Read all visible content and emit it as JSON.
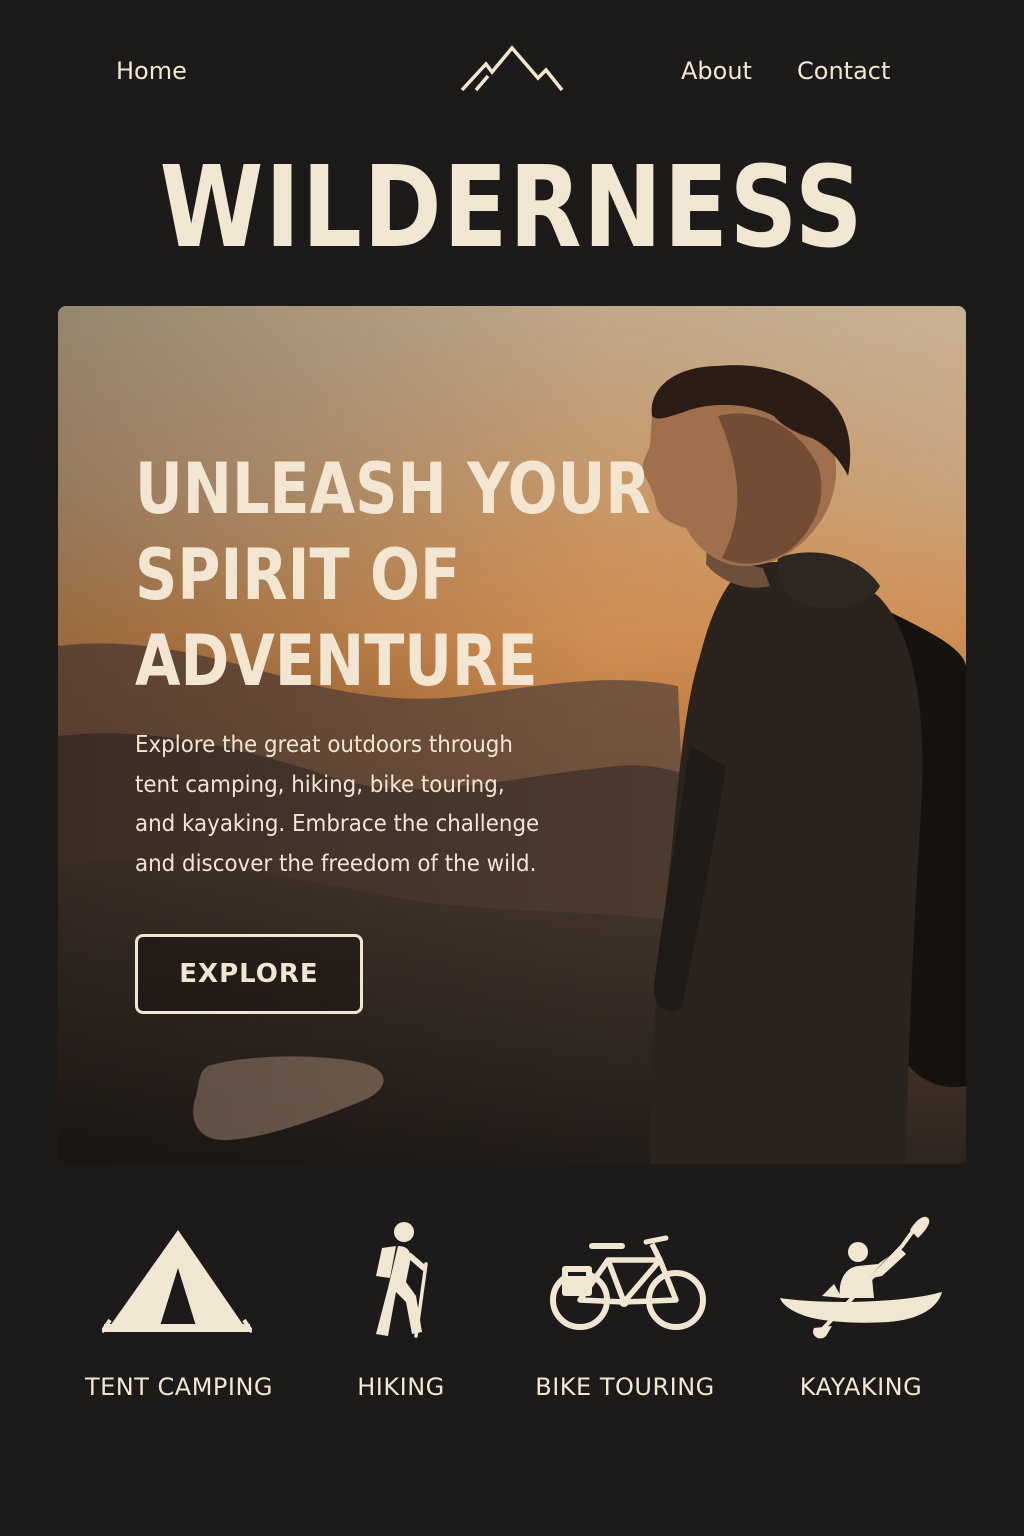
{
  "nav": {
    "home": "Home",
    "about": "About",
    "contact": "Contact",
    "logo_icon": "mountain-icon"
  },
  "brand": {
    "title": "WILDERNESS"
  },
  "hero": {
    "heading_lines": [
      "UNLEASH YOUR",
      "SPIRIT OF",
      "ADVENTURE"
    ],
    "text_lines": [
      "Explore the great outdoors through",
      "tent camping, hiking, bike touring,",
      "and kayaking. Embrace the challenge",
      "and discover the freedom of the wild."
    ],
    "cta_label": "EXPLORE"
  },
  "activities": [
    {
      "label": "TENT CAMPING",
      "icon": "tent-icon"
    },
    {
      "label": "HIKING",
      "icon": "hiker-icon"
    },
    {
      "label": "BIKE TOURING",
      "icon": "bicycle-icon"
    },
    {
      "label": "KAYAKING",
      "icon": "kayaker-icon"
    }
  ],
  "colors": {
    "background": "#1c1b1a",
    "text": "#f1e6d2",
    "sky_top": "#c8b294",
    "sky_glow": "#d8914e"
  }
}
